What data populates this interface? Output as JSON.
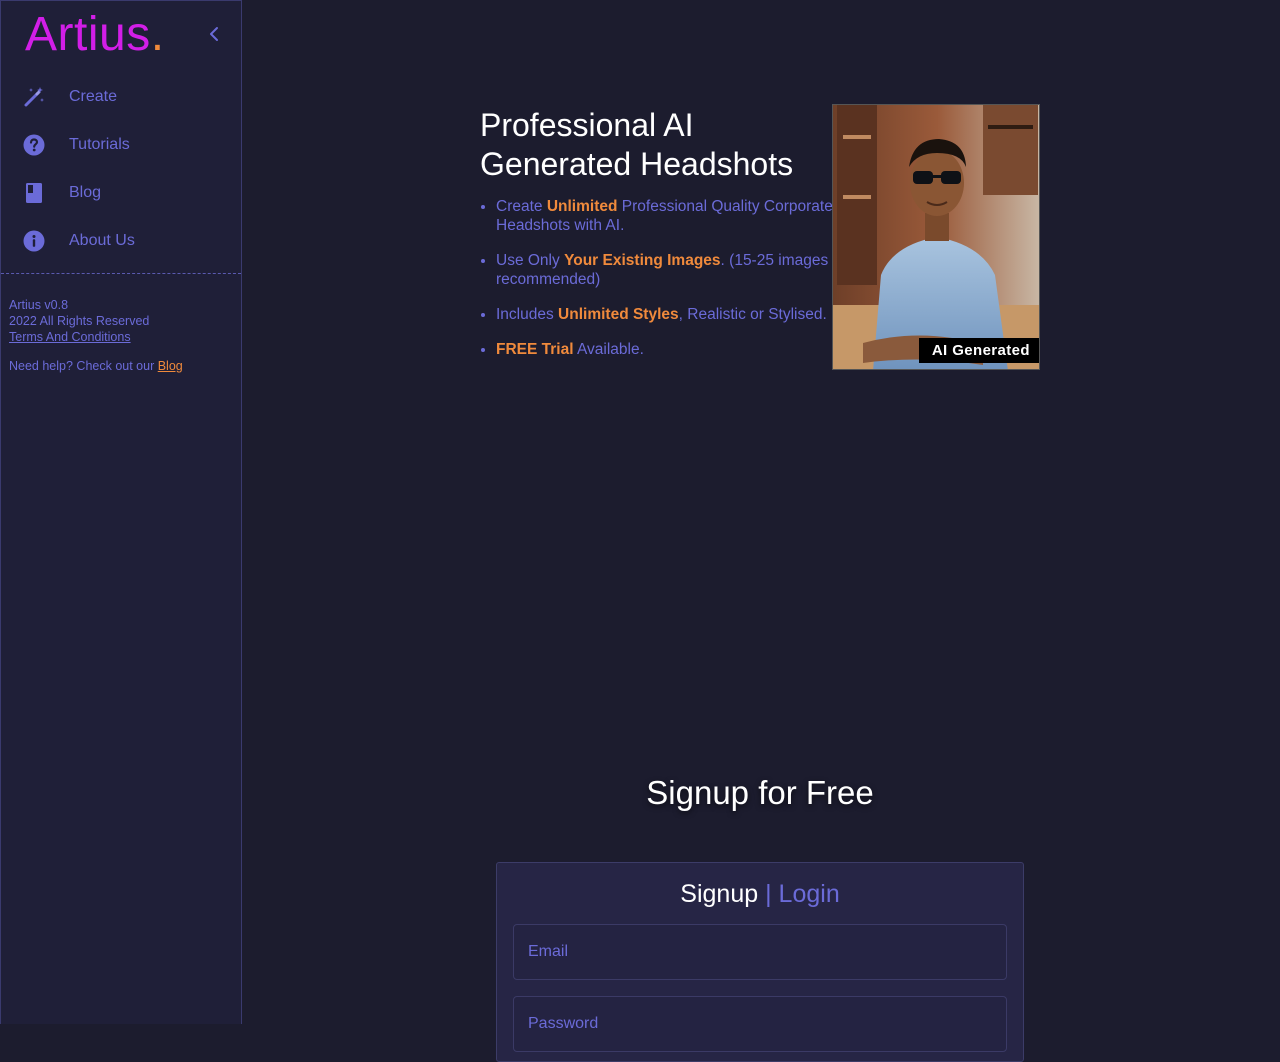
{
  "sidebar": {
    "brand": "Artius",
    "brand_dot": ".",
    "nav": [
      {
        "label": "Create",
        "icon": "magic-wand-icon"
      },
      {
        "label": "Tutorials",
        "icon": "question-circle-icon"
      },
      {
        "label": "Blog",
        "icon": "book-icon"
      },
      {
        "label": "About Us",
        "icon": "info-circle-icon"
      }
    ],
    "footer": {
      "version": "Artius v0.8",
      "rights": "2022 All Rights Reserved",
      "terms": "Terms And Conditions",
      "help_prefix": "Need help? Check out our ",
      "help_link": "Blog"
    }
  },
  "hero": {
    "title": "Professional AI Generated Headshots",
    "bullets": [
      {
        "pre": "Create ",
        "hl": "Unlimited",
        "post": " Professional Quality Corporate Headshots with AI."
      },
      {
        "pre": "Use Only ",
        "hl": "Your Existing Images",
        "post": ". (15-25 images recommended)"
      },
      {
        "pre": "Includes ",
        "hl": "Unlimited Styles",
        "post": ", Realistic or Stylised."
      },
      {
        "pre": "",
        "hl": "FREE Trial",
        "post": " Available."
      }
    ],
    "photo_badge": "AI Generated"
  },
  "signup": {
    "heading": "Signup for Free",
    "tab_signup": "Signup",
    "tab_separator": "|",
    "tab_login": "Login",
    "email_placeholder": "Email",
    "password_placeholder": "Password"
  },
  "colors": {
    "background": "#1c1c2e",
    "sidebar": "#1f1f38",
    "brand": "#d21ee8",
    "accent": "#f08a3c",
    "muted": "#6b6bd8"
  }
}
